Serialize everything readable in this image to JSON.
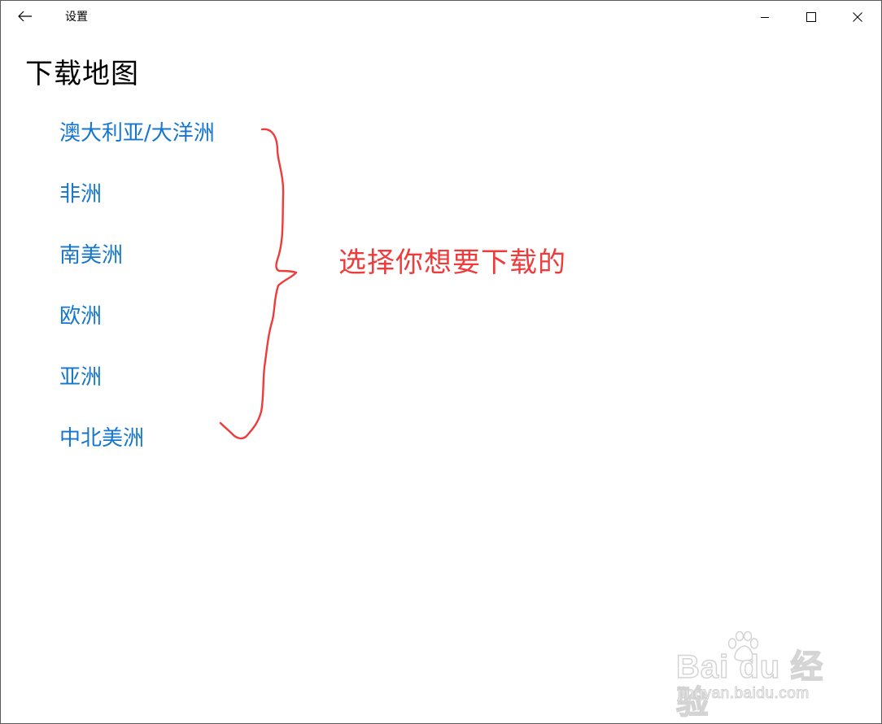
{
  "window": {
    "title": "设置",
    "back_icon": "back-arrow-icon",
    "controls": {
      "minimize_icon": "minimize-icon",
      "maximize_icon": "maximize-icon",
      "close_icon": "close-icon"
    }
  },
  "page": {
    "title": "下载地图",
    "regions": [
      {
        "label": "澳大利亚/大洋洲"
      },
      {
        "label": "非洲"
      },
      {
        "label": "南美洲"
      },
      {
        "label": "欧洲"
      },
      {
        "label": "亚洲"
      },
      {
        "label": "中北美洲"
      }
    ],
    "link_color": "#1576cd"
  },
  "annotation": {
    "text": "选择你想要下载的",
    "color": "#ee3b3b"
  },
  "watermark": {
    "logo": "Bai du 经验",
    "url": "jingyan.baidu.com"
  }
}
